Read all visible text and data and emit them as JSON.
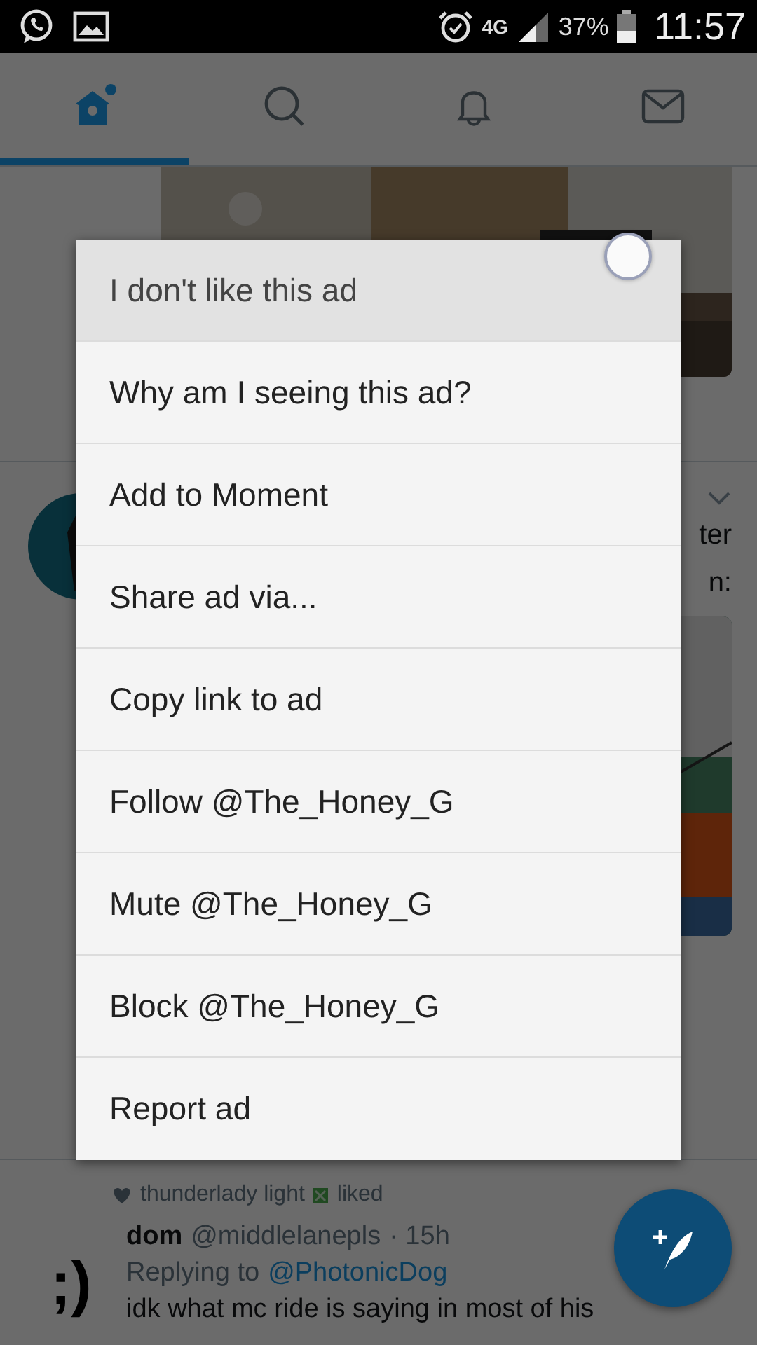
{
  "status_bar": {
    "network": "4G",
    "battery": "37%",
    "time": "11:57"
  },
  "tabs": [
    {
      "kind": "home",
      "selected": true
    },
    {
      "kind": "search",
      "selected": false
    },
    {
      "kind": "notifications",
      "selected": false
    },
    {
      "kind": "messages",
      "selected": false
    }
  ],
  "feed": {
    "tweet_fragments": [
      "ter",
      "n:"
    ],
    "liked_by": {
      "name": "thunderlady light",
      "action": "liked"
    },
    "tweet": {
      "avatar_text": ";)",
      "name": "dom",
      "handle": "@middlelanepls",
      "time": "· 15h",
      "reply_label": "Replying to",
      "reply_to": "@PhotonicDog",
      "text": "idk what mc ride is saying in most of his"
    }
  },
  "menu": {
    "items": [
      {
        "label": "I don't like this ad",
        "selected": true
      },
      {
        "label": "Why am I seeing this ad?",
        "selected": false
      },
      {
        "label": "Add to Moment",
        "selected": false
      },
      {
        "label": "Share ad via...",
        "selected": false
      },
      {
        "label": "Copy link to ad",
        "selected": false
      },
      {
        "label": "Follow @The_Honey_G",
        "selected": false
      },
      {
        "label": "Mute @The_Honey_G",
        "selected": false
      },
      {
        "label": "Block @The_Honey_G",
        "selected": false
      },
      {
        "label": "Report ad",
        "selected": false
      }
    ]
  }
}
